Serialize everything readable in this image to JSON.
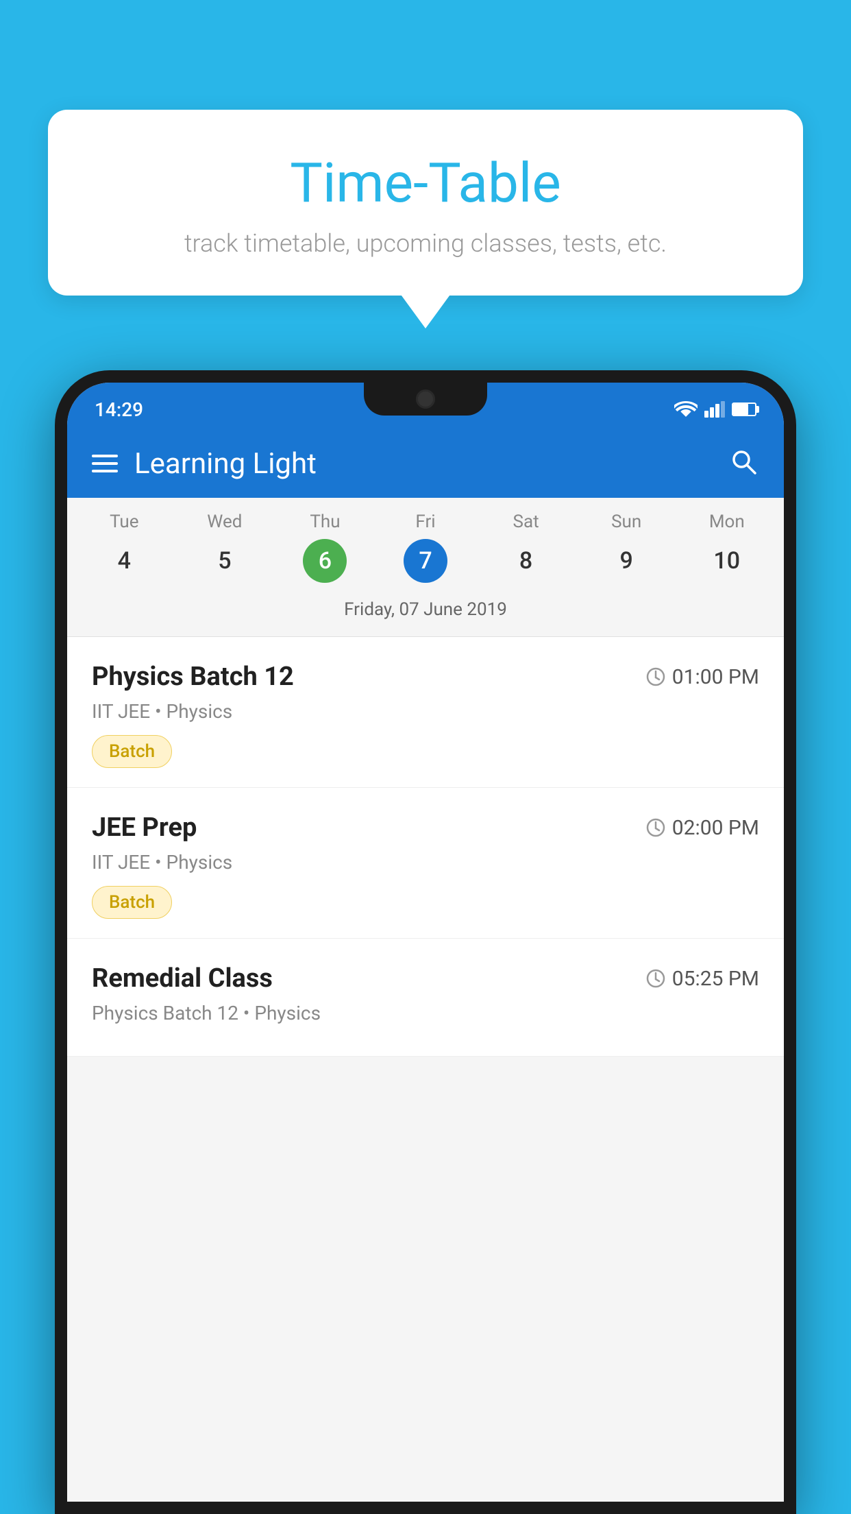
{
  "background_color": "#29b6e8",
  "tooltip": {
    "title": "Time-Table",
    "subtitle": "track timetable, upcoming classes, tests, etc."
  },
  "phone": {
    "status_bar": {
      "time": "14:29"
    },
    "app_bar": {
      "title": "Learning Light"
    },
    "calendar": {
      "days": [
        {
          "label": "Tue",
          "number": "4",
          "state": "normal"
        },
        {
          "label": "Wed",
          "number": "5",
          "state": "normal"
        },
        {
          "label": "Thu",
          "number": "6",
          "state": "today"
        },
        {
          "label": "Fri",
          "number": "7",
          "state": "selected"
        },
        {
          "label": "Sat",
          "number": "8",
          "state": "normal"
        },
        {
          "label": "Sun",
          "number": "9",
          "state": "normal"
        },
        {
          "label": "Mon",
          "number": "10",
          "state": "normal"
        }
      ],
      "selected_date_label": "Friday, 07 June 2019"
    },
    "schedule": [
      {
        "title": "Physics Batch 12",
        "time": "01:00 PM",
        "meta": "IIT JEE • Physics",
        "badge": "Batch"
      },
      {
        "title": "JEE Prep",
        "time": "02:00 PM",
        "meta": "IIT JEE • Physics",
        "badge": "Batch"
      },
      {
        "title": "Remedial Class",
        "time": "05:25 PM",
        "meta": "Physics Batch 12 • Physics",
        "badge": null
      }
    ]
  }
}
